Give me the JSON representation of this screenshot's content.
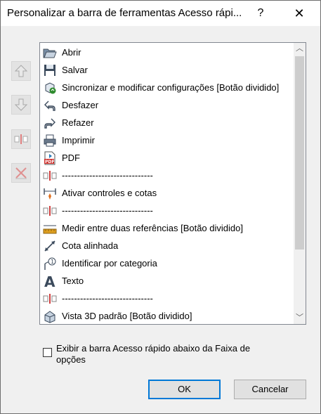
{
  "dialog": {
    "title": "Personalizar a barra de ferramentas Acesso rápi...",
    "help_label": "?",
    "close_label": "✕"
  },
  "side_buttons": [
    {
      "name": "move-up",
      "icon": "arrow-up-icon"
    },
    {
      "name": "move-down",
      "icon": "arrow-down-icon"
    },
    {
      "name": "add-separator",
      "icon": "separator-icon"
    },
    {
      "name": "remove",
      "icon": "remove-icon"
    }
  ],
  "list": {
    "items": [
      {
        "label": "Abrir",
        "icon": "folder-open-icon"
      },
      {
        "label": "Salvar",
        "icon": "floppy-disk-icon"
      },
      {
        "label": "Sincronizar e modificar configurações [Botão dividido]",
        "icon": "sync-icon"
      },
      {
        "label": "Desfazer",
        "icon": "undo-icon"
      },
      {
        "label": "Refazer",
        "icon": "redo-icon"
      },
      {
        "label": "Imprimir",
        "icon": "printer-icon"
      },
      {
        "label": "PDF",
        "icon": "pdf-icon"
      },
      {
        "label": "------------------------------",
        "icon": "separator-icon"
      },
      {
        "label": "Ativar controles e cotas",
        "icon": "dimension-controls-icon"
      },
      {
        "label": "------------------------------",
        "icon": "separator-icon"
      },
      {
        "label": "Medir entre duas referências [Botão dividido]",
        "icon": "measure-icon"
      },
      {
        "label": "Cota alinhada",
        "icon": "aligned-dimension-icon"
      },
      {
        "label": "Identificar por categoria",
        "icon": "tag-icon"
      },
      {
        "label": "Texto",
        "icon": "text-icon"
      },
      {
        "label": "------------------------------",
        "icon": "separator-icon"
      },
      {
        "label": "Vista 3D padrão [Botão dividido]",
        "icon": "3d-view-icon"
      }
    ]
  },
  "checkbox": {
    "label": "Exibir a barra Acesso rápido abaixo da Faixa de opções",
    "checked": false
  },
  "buttons": {
    "ok_label": "OK",
    "cancel_label": "Cancelar"
  },
  "colors": {
    "accent": "#0078d7",
    "separator_red": "#d04040"
  }
}
